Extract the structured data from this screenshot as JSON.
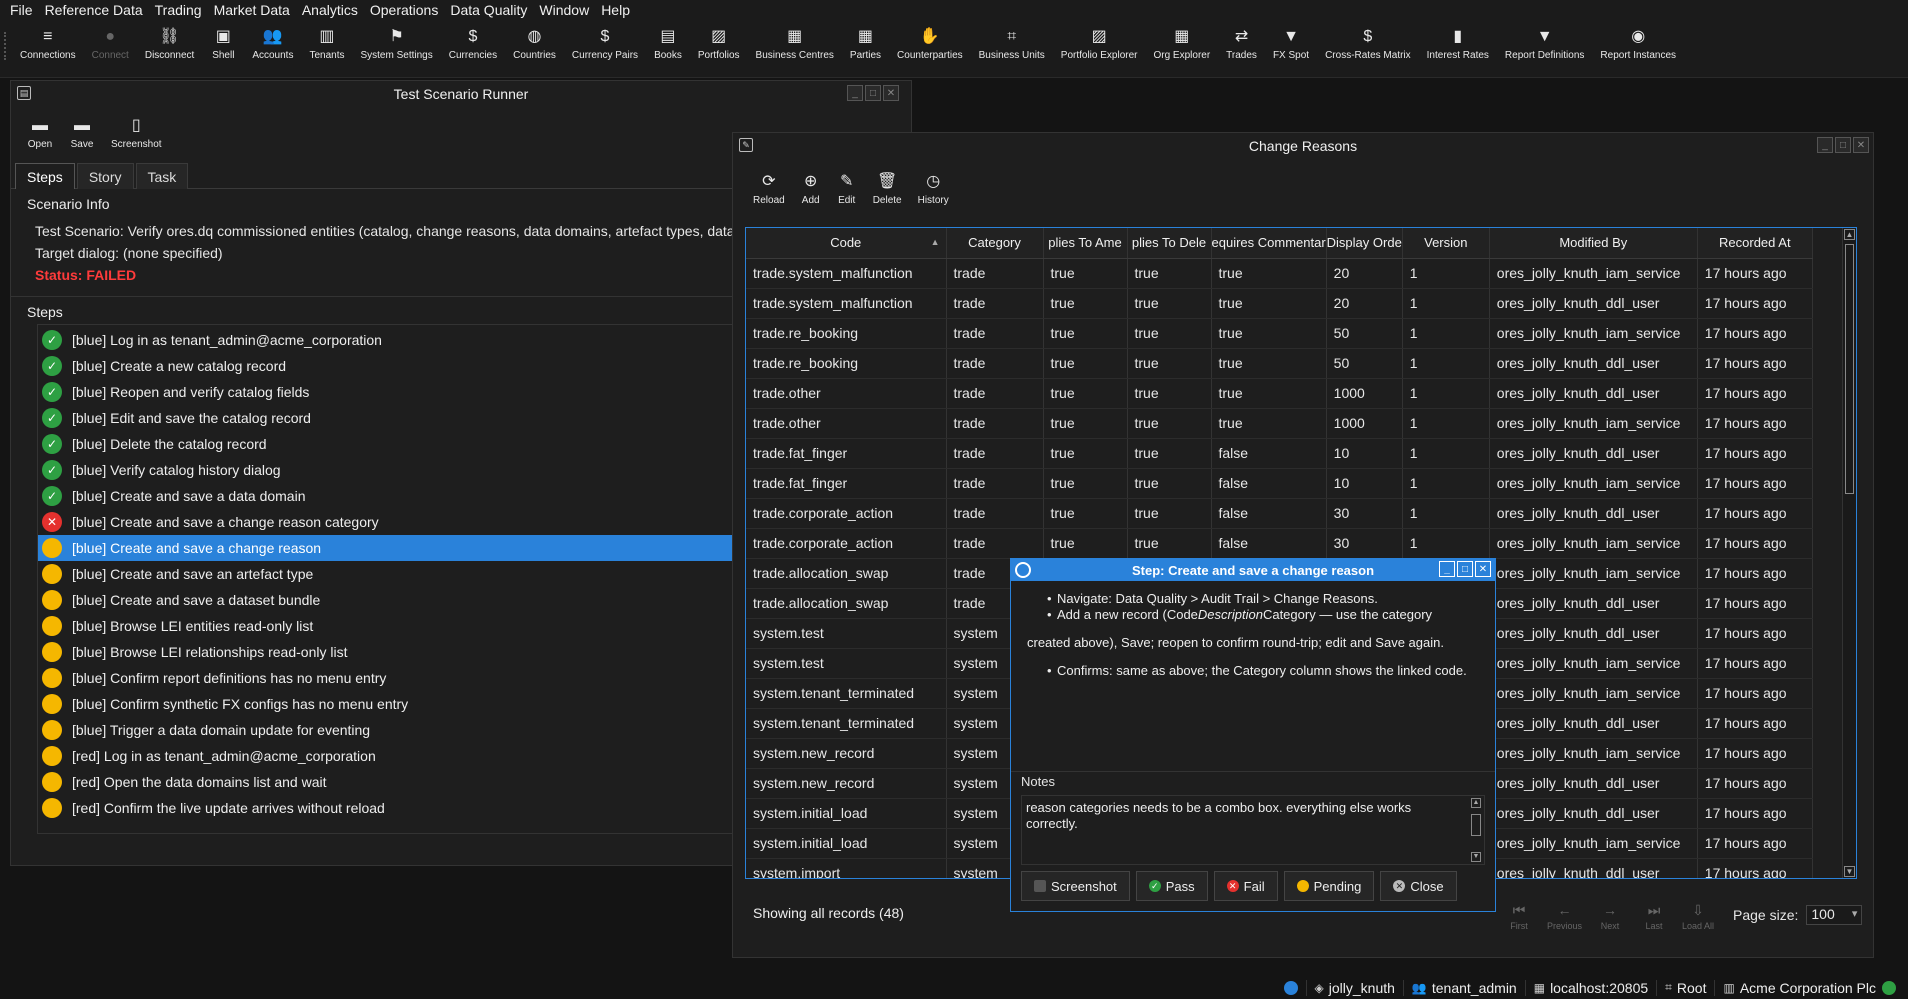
{
  "menu": [
    "File",
    "Reference Data",
    "Trading",
    "Market Data",
    "Analytics",
    "Operations",
    "Data Quality",
    "Window",
    "Help"
  ],
  "toolbar": [
    {
      "label": "Connections",
      "icon": "≡",
      "name": "connections"
    },
    {
      "label": "Connect",
      "icon": "●",
      "name": "connect",
      "disabled": true
    },
    {
      "label": "Disconnect",
      "icon": "⛓",
      "name": "disconnect"
    },
    {
      "label": "Shell",
      "icon": "▣",
      "name": "shell"
    },
    {
      "label": "Accounts",
      "icon": "👥",
      "name": "accounts"
    },
    {
      "label": "Tenants",
      "icon": "▥",
      "name": "tenants"
    },
    {
      "label": "System Settings",
      "icon": "⚑",
      "name": "system-settings"
    },
    {
      "label": "Currencies",
      "icon": "$",
      "name": "currencies"
    },
    {
      "label": "Countries",
      "icon": "◍",
      "name": "countries"
    },
    {
      "label": "Currency Pairs",
      "icon": "$",
      "name": "currency-pairs"
    },
    {
      "label": "Books",
      "icon": "▤",
      "name": "books"
    },
    {
      "label": "Portfolios",
      "icon": "▨",
      "name": "portfolios"
    },
    {
      "label": "Business Centres",
      "icon": "▦",
      "name": "business-centres"
    },
    {
      "label": "Parties",
      "icon": "▦",
      "name": "parties"
    },
    {
      "label": "Counterparties",
      "icon": "✋",
      "name": "counterparties"
    },
    {
      "label": "Business Units",
      "icon": "⌗",
      "name": "business-units"
    },
    {
      "label": "Portfolio Explorer",
      "icon": "▨",
      "name": "portfolio-explorer"
    },
    {
      "label": "Org Explorer",
      "icon": "▦",
      "name": "org-explorer"
    },
    {
      "label": "Trades",
      "icon": "⇄",
      "name": "trades"
    },
    {
      "label": "FX Spot",
      "icon": "▼",
      "name": "fx-spot"
    },
    {
      "label": "Cross-Rates Matrix",
      "icon": "$",
      "name": "cross-rates-matrix"
    },
    {
      "label": "Interest Rates",
      "icon": "▮",
      "name": "interest-rates"
    },
    {
      "label": "Report Definitions",
      "icon": "▼",
      "name": "report-definitions"
    },
    {
      "label": "Report Instances",
      "icon": "◉",
      "name": "report-instances"
    }
  ],
  "tsr": {
    "title": "Test Scenario Runner",
    "toolbar": [
      {
        "label": "Open",
        "icon": "▬",
        "name": "open"
      },
      {
        "label": "Save",
        "icon": "▬",
        "name": "save"
      },
      {
        "label": "Screenshot",
        "icon": "▯",
        "name": "screenshot"
      }
    ],
    "tabs": [
      "Steps",
      "Story",
      "Task"
    ],
    "info_label": "Scenario Info",
    "scenario_line": "Test Scenario: Verify ores.dq commissioned entities (catalog, change reasons, data domains, artefact types, data:",
    "target_line": "Target dialog: (none specified)",
    "status": "Status: FAILED",
    "steps_label": "Steps",
    "steps": [
      {
        "text": "[blue] Log in as tenant_admin@acme_corporation",
        "state": "pass"
      },
      {
        "text": "[blue] Create a new catalog record",
        "state": "pass"
      },
      {
        "text": "[blue] Reopen and verify catalog fields",
        "state": "pass"
      },
      {
        "text": "[blue] Edit and save the catalog record",
        "state": "pass"
      },
      {
        "text": "[blue] Delete the catalog record",
        "state": "pass"
      },
      {
        "text": "[blue] Verify catalog history dialog",
        "state": "pass"
      },
      {
        "text": "[blue] Create and save a data domain",
        "state": "pass"
      },
      {
        "text": "[blue] Create and save a change reason category",
        "state": "fail"
      },
      {
        "text": "[blue] Create and save a change reason",
        "state": "pending",
        "selected": true
      },
      {
        "text": "[blue] Create and save an artefact type",
        "state": "pending"
      },
      {
        "text": "[blue] Create and save a dataset bundle",
        "state": "pending"
      },
      {
        "text": "[blue] Browse LEI entities read-only list",
        "state": "pending"
      },
      {
        "text": "[blue] Browse LEI relationships read-only list",
        "state": "pending"
      },
      {
        "text": "[blue] Confirm report definitions has no menu entry",
        "state": "pending"
      },
      {
        "text": "[blue] Confirm synthetic FX configs has no menu entry",
        "state": "pending"
      },
      {
        "text": "[blue] Trigger a data domain update for eventing",
        "state": "pending"
      },
      {
        "text": "[red] Log in as tenant_admin@acme_corporation",
        "state": "pending"
      },
      {
        "text": "[red] Open the data domains list and wait",
        "state": "pending"
      },
      {
        "text": "[red] Confirm the live update arrives without reload",
        "state": "pending"
      }
    ]
  },
  "cr": {
    "title": "Change Reasons",
    "toolbar": [
      {
        "label": "Reload",
        "icon": "⟳",
        "name": "reload"
      },
      {
        "label": "Add",
        "icon": "⊕",
        "name": "add"
      },
      {
        "label": "Edit",
        "icon": "✎",
        "name": "edit"
      },
      {
        "label": "Delete",
        "icon": "🗑",
        "name": "delete"
      },
      {
        "label": "History",
        "icon": "◷",
        "name": "history"
      }
    ],
    "columns": [
      "Code",
      "Category",
      "plies To Ame",
      "plies To Dele",
      "equires Commentar",
      "Display Orde",
      "Version",
      "Modified By",
      "Recorded At"
    ],
    "rows": [
      [
        "trade.system_malfunction",
        "trade",
        "true",
        "true",
        "true",
        "20",
        "1",
        "ores_jolly_knuth_iam_service",
        "17 hours ago"
      ],
      [
        "trade.system_malfunction",
        "trade",
        "true",
        "true",
        "true",
        "20",
        "1",
        "ores_jolly_knuth_ddl_user",
        "17 hours ago"
      ],
      [
        "trade.re_booking",
        "trade",
        "true",
        "true",
        "true",
        "50",
        "1",
        "ores_jolly_knuth_iam_service",
        "17 hours ago"
      ],
      [
        "trade.re_booking",
        "trade",
        "true",
        "true",
        "true",
        "50",
        "1",
        "ores_jolly_knuth_ddl_user",
        "17 hours ago"
      ],
      [
        "trade.other",
        "trade",
        "true",
        "true",
        "true",
        "1000",
        "1",
        "ores_jolly_knuth_ddl_user",
        "17 hours ago"
      ],
      [
        "trade.other",
        "trade",
        "true",
        "true",
        "true",
        "1000",
        "1",
        "ores_jolly_knuth_iam_service",
        "17 hours ago"
      ],
      [
        "trade.fat_finger",
        "trade",
        "true",
        "true",
        "false",
        "10",
        "1",
        "ores_jolly_knuth_ddl_user",
        "17 hours ago"
      ],
      [
        "trade.fat_finger",
        "trade",
        "true",
        "true",
        "false",
        "10",
        "1",
        "ores_jolly_knuth_iam_service",
        "17 hours ago"
      ],
      [
        "trade.corporate_action",
        "trade",
        "true",
        "true",
        "false",
        "30",
        "1",
        "ores_jolly_knuth_ddl_user",
        "17 hours ago"
      ],
      [
        "trade.corporate_action",
        "trade",
        "true",
        "true",
        "false",
        "30",
        "1",
        "ores_jolly_knuth_iam_service",
        "17 hours ago"
      ],
      [
        "trade.allocation_swap",
        "trade",
        "",
        "",
        "",
        "",
        "",
        "ores_jolly_knuth_iam_service",
        "17 hours ago"
      ],
      [
        "trade.allocation_swap",
        "trade",
        "",
        "",
        "",
        "",
        "",
        "ores_jolly_knuth_ddl_user",
        "17 hours ago"
      ],
      [
        "system.test",
        "system",
        "",
        "",
        "",
        "",
        "",
        "ores_jolly_knuth_ddl_user",
        "17 hours ago"
      ],
      [
        "system.test",
        "system",
        "",
        "",
        "",
        "",
        "",
        "ores_jolly_knuth_iam_service",
        "17 hours ago"
      ],
      [
        "system.tenant_terminated",
        "system",
        "",
        "",
        "",
        "",
        "",
        "ores_jolly_knuth_iam_service",
        "17 hours ago"
      ],
      [
        "system.tenant_terminated",
        "system",
        "",
        "",
        "",
        "",
        "",
        "ores_jolly_knuth_ddl_user",
        "17 hours ago"
      ],
      [
        "system.new_record",
        "system",
        "",
        "",
        "",
        "",
        "",
        "ores_jolly_knuth_iam_service",
        "17 hours ago"
      ],
      [
        "system.new_record",
        "system",
        "",
        "",
        "",
        "",
        "",
        "ores_jolly_knuth_ddl_user",
        "17 hours ago"
      ],
      [
        "system.initial_load",
        "system",
        "",
        "",
        "",
        "",
        "",
        "ores_jolly_knuth_ddl_user",
        "17 hours ago"
      ],
      [
        "system.initial_load",
        "system",
        "",
        "",
        "",
        "",
        "",
        "ores_jolly_knuth_iam_service",
        "17 hours ago"
      ],
      [
        "system.import",
        "system",
        "",
        "",
        "",
        "",
        "",
        "ores_jolly_knuth_ddl_user",
        "17 hours ago"
      ]
    ],
    "records_info": "Showing all records (48)",
    "pager": [
      {
        "label": "First",
        "icon": "⏮",
        "name": "first"
      },
      {
        "label": "Previous",
        "icon": "←",
        "name": "previous"
      },
      {
        "label": "Next",
        "icon": "→",
        "name": "next"
      },
      {
        "label": "Last",
        "icon": "⏭",
        "name": "last"
      },
      {
        "label": "Load All",
        "icon": "⇩",
        "name": "load-all"
      }
    ],
    "page_size_label": "Page size:",
    "page_size": "100"
  },
  "step_dialog": {
    "title": "Step: Create and save a change reason",
    "bullet1": "Navigate: Data Quality > Audit Trail > Change Reasons.",
    "bullet2_a": "Add a new record (Code",
    "bullet2_em": "Description",
    "bullet2_b": "Category — use the category",
    "para": "created above), Save; reopen to confirm round-trip; edit and Save again.",
    "bullet3": "Confirms: same as above; the Category column shows the linked code.",
    "notes_label": "Notes",
    "notes": "reason categories needs to be a combo box. everything else works correctly.",
    "buttons": [
      {
        "label": "Screenshot",
        "name": "screenshot",
        "color": "#555555"
      },
      {
        "label": "Pass",
        "name": "pass",
        "color": "#2ea043"
      },
      {
        "label": "Fail",
        "name": "fail",
        "color": "#e5312e"
      },
      {
        "label": "Pending",
        "name": "pending",
        "color": "#f5b700"
      },
      {
        "label": "Close",
        "name": "close",
        "color": "#bbbbbb"
      }
    ]
  },
  "statusbar": {
    "user": "jolly_knuth",
    "role": "tenant_admin",
    "host": "localhost:20805",
    "scope": "Root",
    "tenant": "Acme Corporation Plc"
  }
}
